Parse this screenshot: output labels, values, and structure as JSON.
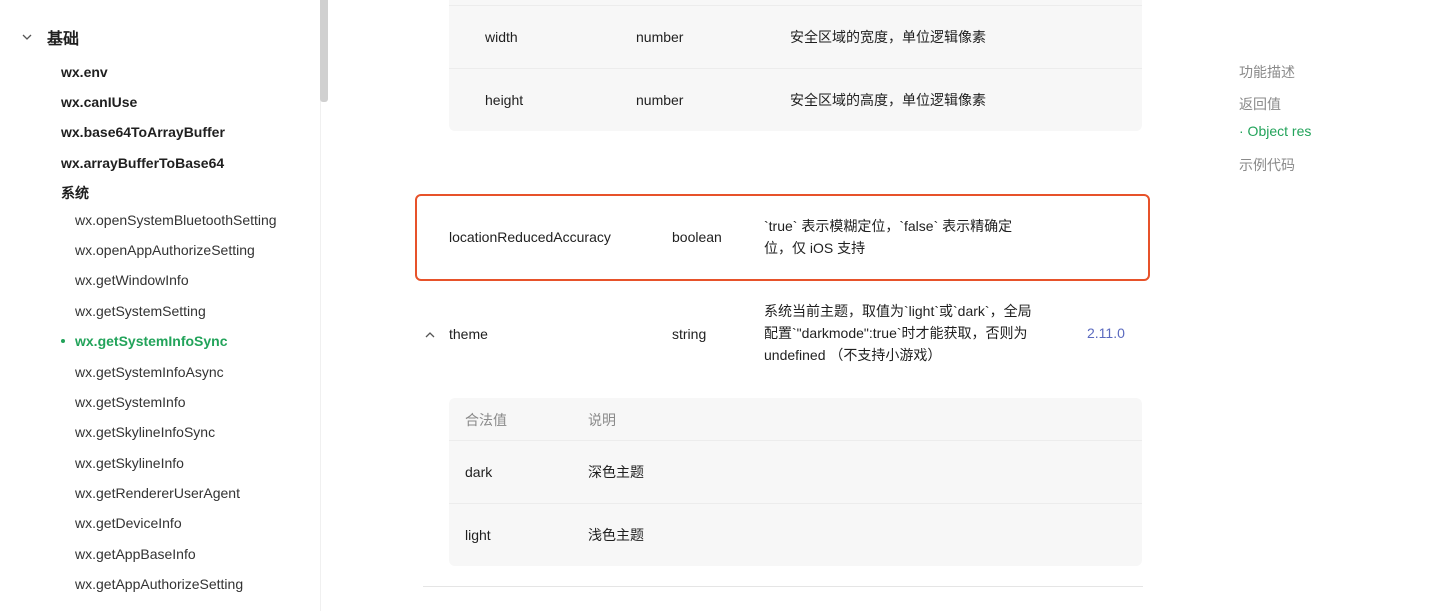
{
  "sidebar": {
    "section_title": "基础",
    "items_l1": [
      "wx.env",
      "wx.canIUse",
      "wx.base64ToArrayBuffer",
      "wx.arrayBufferToBase64"
    ],
    "group_title": "系统",
    "items_l2": [
      "wx.openSystemBluetoothSetting",
      "wx.openAppAuthorizeSetting",
      "wx.getWindowInfo",
      "wx.getSystemSetting",
      "wx.getSystemInfoSync",
      "wx.getSystemInfoAsync",
      "wx.getSystemInfo",
      "wx.getSkylineInfoSync",
      "wx.getSkylineInfo",
      "wx.getRendererUserAgent",
      "wx.getDeviceInfo",
      "wx.getAppBaseInfo",
      "wx.getAppAuthorizeSetting"
    ],
    "active_item": "wx.getSystemInfoSync",
    "active_color": "#22a35a"
  },
  "safe_area_rows": [
    {
      "name": "width",
      "type": "number",
      "desc": "安全区域的宽度，单位逻辑像素"
    },
    {
      "name": "height",
      "type": "number",
      "desc": "安全区域的高度，单位逻辑像素"
    }
  ],
  "highlighted_row": {
    "name": "locationReducedAccuracy",
    "type": "boolean",
    "desc_line1": "`true` 表示模糊定位，`false` 表示精确定",
    "desc_line2": "位，仅 iOS 支持",
    "border_color": "#e7522a"
  },
  "theme_row": {
    "name": "theme",
    "type": "string",
    "desc_line1": "系统当前主题，取值为`light`或`dark`，全局",
    "desc_line2": "配置`\"darkmode\":true`时才能获取，否则为",
    "desc_line3": "undefined （不支持小游戏）",
    "version": "2.11.0",
    "sub_table": {
      "headers": [
        "合法值",
        "说明"
      ],
      "rows": [
        {
          "value": "dark",
          "desc": "深色主题"
        },
        {
          "value": "light",
          "desc": "浅色主题"
        }
      ]
    }
  },
  "toc": {
    "items": [
      "功能描述",
      "返回值",
      "· Object res",
      "示例代码"
    ],
    "active_index": 2
  }
}
